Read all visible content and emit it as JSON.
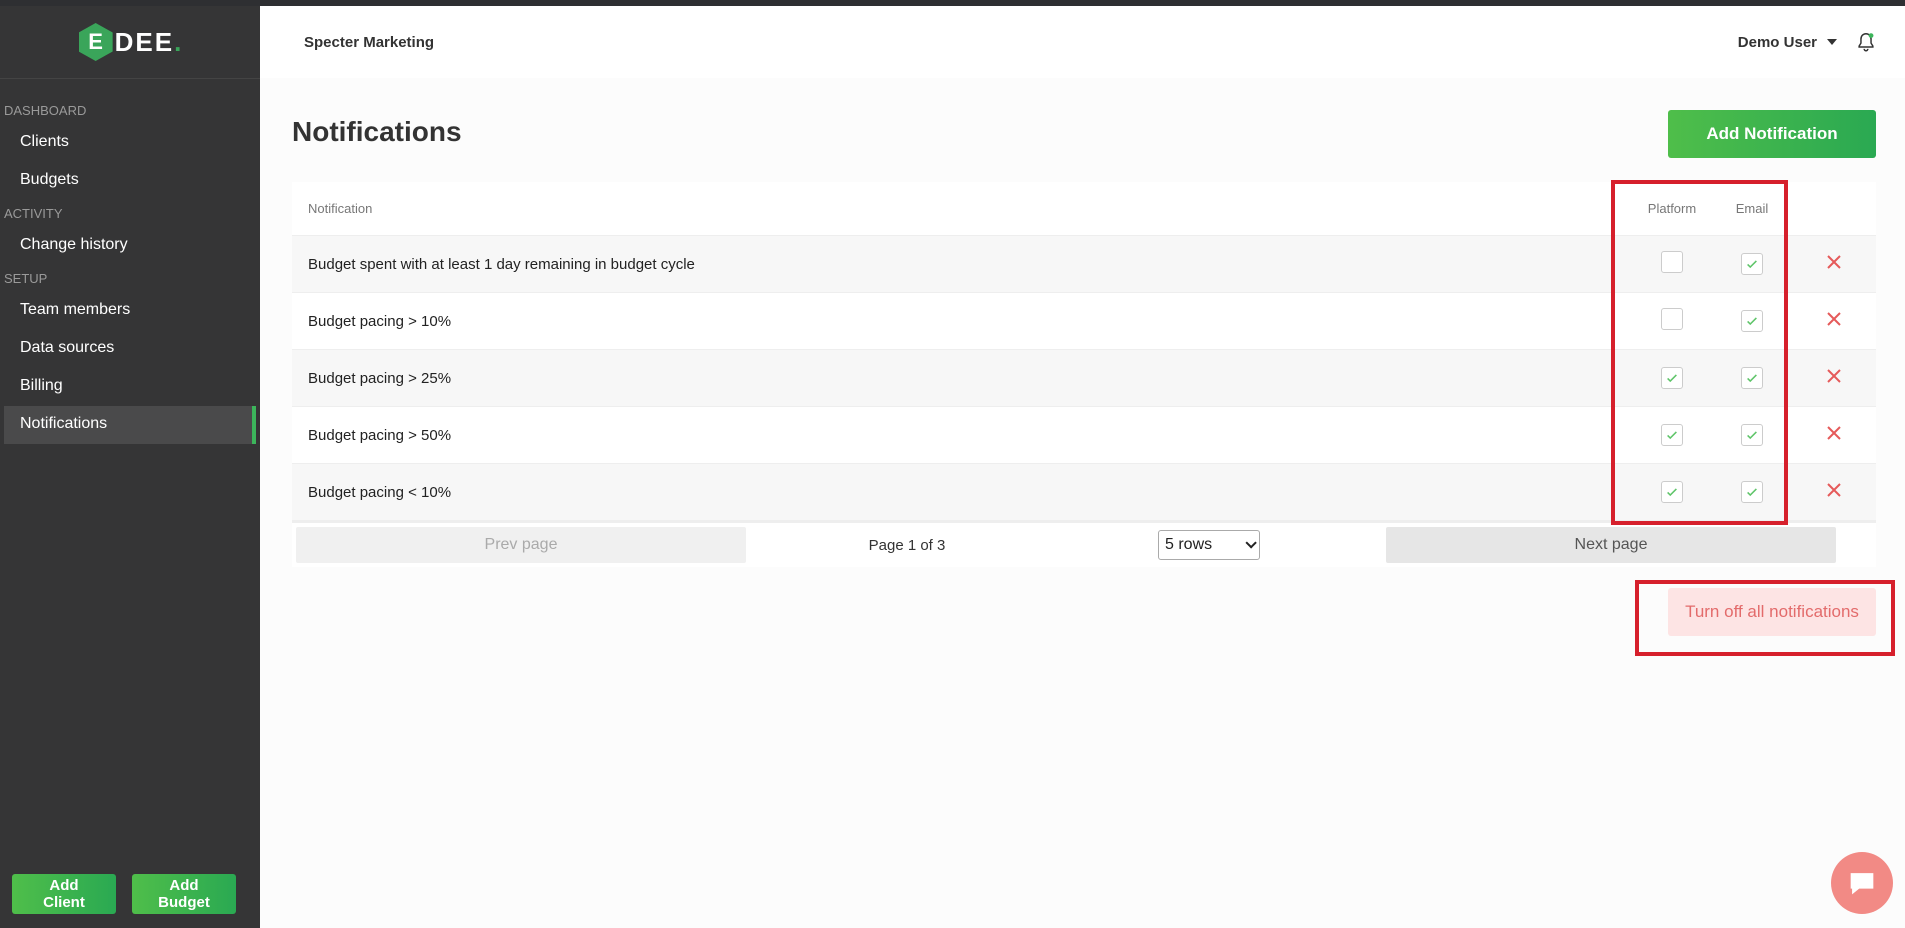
{
  "brand": {
    "logo_letter": "E",
    "logo_text": "DEE",
    "logo_dot": "."
  },
  "sidebar": {
    "sections": [
      {
        "label": "DASHBOARD",
        "items": [
          "Clients",
          "Budgets"
        ]
      },
      {
        "label": "ACTIVITY",
        "items": [
          "Change history"
        ]
      },
      {
        "label": "SETUP",
        "items": [
          "Team members",
          "Data sources",
          "Billing",
          "Notifications"
        ]
      }
    ],
    "active_item": "Notifications",
    "add_client": "Add Client",
    "add_budget": "Add Budget"
  },
  "header": {
    "company": "Specter Marketing",
    "user": "Demo User"
  },
  "page": {
    "title": "Notifications",
    "add_button": "Add Notification",
    "turn_off_all": "Turn off all notifications"
  },
  "table": {
    "headers": {
      "notification": "Notification",
      "platform": "Platform",
      "email": "Email"
    },
    "rows": [
      {
        "name": "Budget spent with at least 1 day remaining in budget cycle",
        "platform": false,
        "email": true
      },
      {
        "name": "Budget pacing > 10%",
        "platform": false,
        "email": true
      },
      {
        "name": "Budget pacing > 25%",
        "platform": true,
        "email": true
      },
      {
        "name": "Budget pacing > 50%",
        "platform": true,
        "email": true
      },
      {
        "name": "Budget pacing < 10%",
        "platform": true,
        "email": true
      }
    ],
    "pager": {
      "prev": "Prev page",
      "info": "Page 1 of 3",
      "rows": "5 rows",
      "next": "Next page"
    }
  },
  "colors": {
    "accent": "#3cb55b",
    "delete": "#e55a5a",
    "highlight": "#d6202c"
  }
}
